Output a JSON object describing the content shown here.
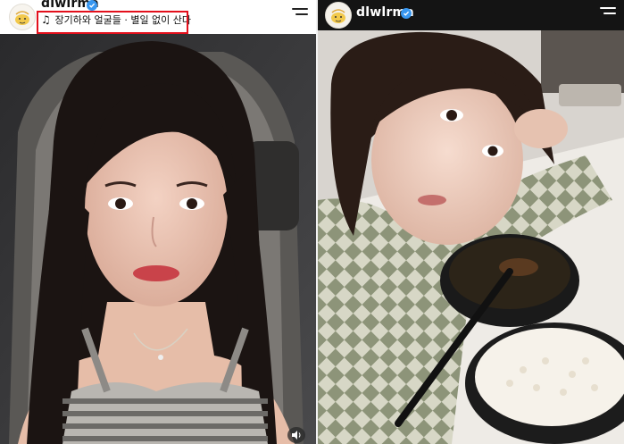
{
  "left_post": {
    "username": "dlwlrma",
    "music": "장기하와 얼굴들 · 별일 없이 산다",
    "note_glyph": "♫",
    "icons": [
      "avatar-icon",
      "verified-badge-icon",
      "menu-icon",
      "speaker-icon"
    ]
  },
  "right_post": {
    "username": "dlwlrma",
    "icons": [
      "avatar-icon",
      "verified-badge-icon",
      "menu-icon"
    ]
  },
  "colors": {
    "highlight_box": "#e3101c",
    "verified": "#3897f0",
    "left_header_bg": "#ffffff",
    "right_header_bg": "#141414"
  }
}
